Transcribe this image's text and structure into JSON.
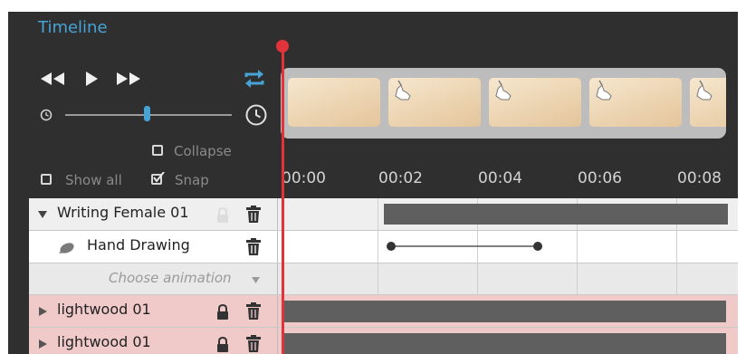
{
  "panel": {
    "title": "Timeline"
  },
  "controls": {
    "icons": [
      "rewind-icon",
      "play-icon",
      "fast-forward-icon",
      "loop-icon",
      "clock-small-icon",
      "clock-large-icon"
    ],
    "speed_level": 0.47,
    "accent_color": "#47a3d6"
  },
  "options": {
    "collapse_label": "Collapse",
    "show_all_label": "Show all",
    "snap_label": "Snap",
    "collapse_checked": false,
    "show_all_checked": false,
    "snap_checked": true
  },
  "ruler": {
    "ticks": [
      "00:00",
      "00:02",
      "00:04",
      "00:06",
      "00:08"
    ]
  },
  "tracks": [
    {
      "name": "Writing Female 01",
      "expanded": true,
      "locked": false
    },
    {
      "name": "Hand Drawing"
    },
    {
      "placeholder": "Choose animation"
    },
    {
      "name": "lightwood 01",
      "expanded": false,
      "locked": true
    },
    {
      "name": "lightwood 01",
      "expanded": false,
      "locked": true
    }
  ],
  "colors": {
    "playhead": "#e3333a",
    "highlight_row": "#f0c9c9",
    "clip": "#5f5f5f"
  }
}
